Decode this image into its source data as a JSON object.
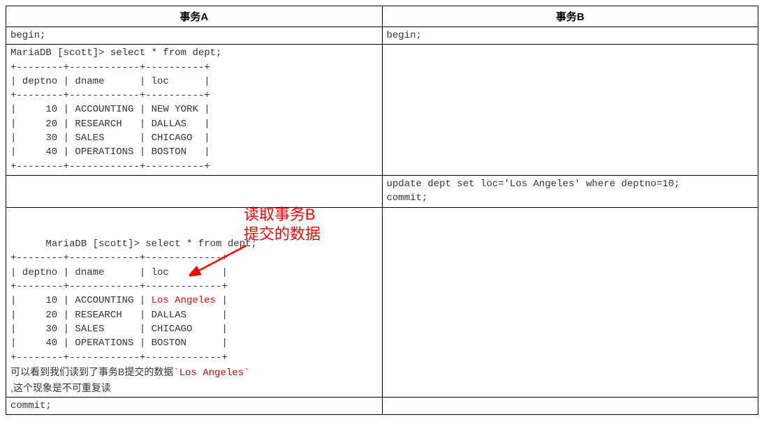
{
  "headers": {
    "colA": "事务A",
    "colB": "事务B"
  },
  "rowA1": "begin;",
  "rowB1": "begin;",
  "queryA1_cmd": "MariaDB [scott]> select * from dept;",
  "sep_line": "+--------+------------+----------+",
  "hdr_line": "| deptno | dname      | loc      |",
  "queryA1_rows": [
    "|     10 | ACCOUNTING | NEW YORK |",
    "|     20 | RESEARCH   | DALLAS   |",
    "|     30 | SALES      | CHICAGO  |",
    "|     40 | OPERATIONS | BOSTON   |"
  ],
  "rowB2_l1": "update dept set loc='Los Angeles' where deptno=10;",
  "rowB2_l2": "commit;",
  "queryA2_cmd": "MariaDB [scott]> select * from dept;",
  "sep_line2": "+--------+------------+-------------+",
  "hdr_line2": "| deptno | dname      | loc         |",
  "queryA2_row1_pre": "|     10 | ACCOUNTING | ",
  "queryA2_row1_red": "Los Angeles",
  "queryA2_row1_post": " |",
  "queryA2_rows_rest": [
    "|     20 | RESEARCH   | DALLAS      |",
    "|     30 | SALES      | CHICAGO     |",
    "|     40 | OPERATIONS | BOSTON      |"
  ],
  "annotation_l1": "读取事务B",
  "annotation_l2": "提交的数据",
  "note_pre": "可以看到我们读到了事务B提交的数据",
  "note_code": "`Los Angeles`",
  "note_post": ",这个现象是不可重复读",
  "rowA_last": "commit;"
}
